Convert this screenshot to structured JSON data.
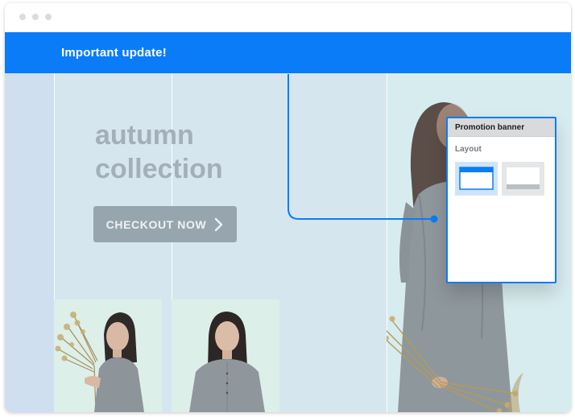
{
  "window": {
    "controls": [
      "window-dot",
      "window-dot",
      "window-dot"
    ]
  },
  "banner": {
    "text": "Important update!",
    "color": "#0a7cf7"
  },
  "hero": {
    "headline_line1": "autumn",
    "headline_line2": "collection",
    "checkout_label": "CHECKOUT NOW",
    "checkout_icon": "chevron-right-icon"
  },
  "popover": {
    "title": "Promotion banner",
    "section_label": "Layout",
    "options": [
      {
        "icon": "top-banner-layout-icon",
        "selected": true
      },
      {
        "icon": "bottom-banner-layout-icon",
        "selected": false
      }
    ],
    "accent": "#0a7cf7"
  },
  "images": [
    "model-photo-with-dried-flowers",
    "model-photo-portrait",
    "model-photo-large"
  ]
}
